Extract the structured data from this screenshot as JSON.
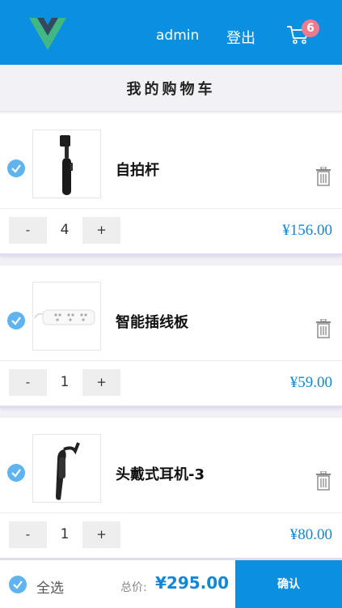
{
  "header": {
    "username": "admin",
    "logout_label": "登出",
    "cart_count": "6",
    "logo_icon": "vue-logo-icon",
    "cart_icon": "shopping-cart-icon"
  },
  "title": "我的购物车",
  "items": [
    {
      "name": "自拍杆",
      "quantity": "4",
      "minus": "-",
      "plus": "+",
      "price": "¥156.00",
      "image": "selfie-stick"
    },
    {
      "name": "智能插线板",
      "quantity": "1",
      "minus": "-",
      "plus": "+",
      "price": "¥59.00",
      "image": "power-strip"
    },
    {
      "name": "头戴式耳机-3",
      "quantity": "1",
      "minus": "-",
      "plus": "+",
      "price": "¥80.00",
      "image": "bluetooth-headset"
    }
  ],
  "footer": {
    "select_all_label": "全选",
    "total_label": "总价:",
    "total_value": "¥295.00",
    "confirm_label": "确认"
  },
  "colors": {
    "primary": "#0b8fe1",
    "check": "#5fb4ef",
    "price": "#1187d6",
    "badge": "#ef7b8e"
  }
}
